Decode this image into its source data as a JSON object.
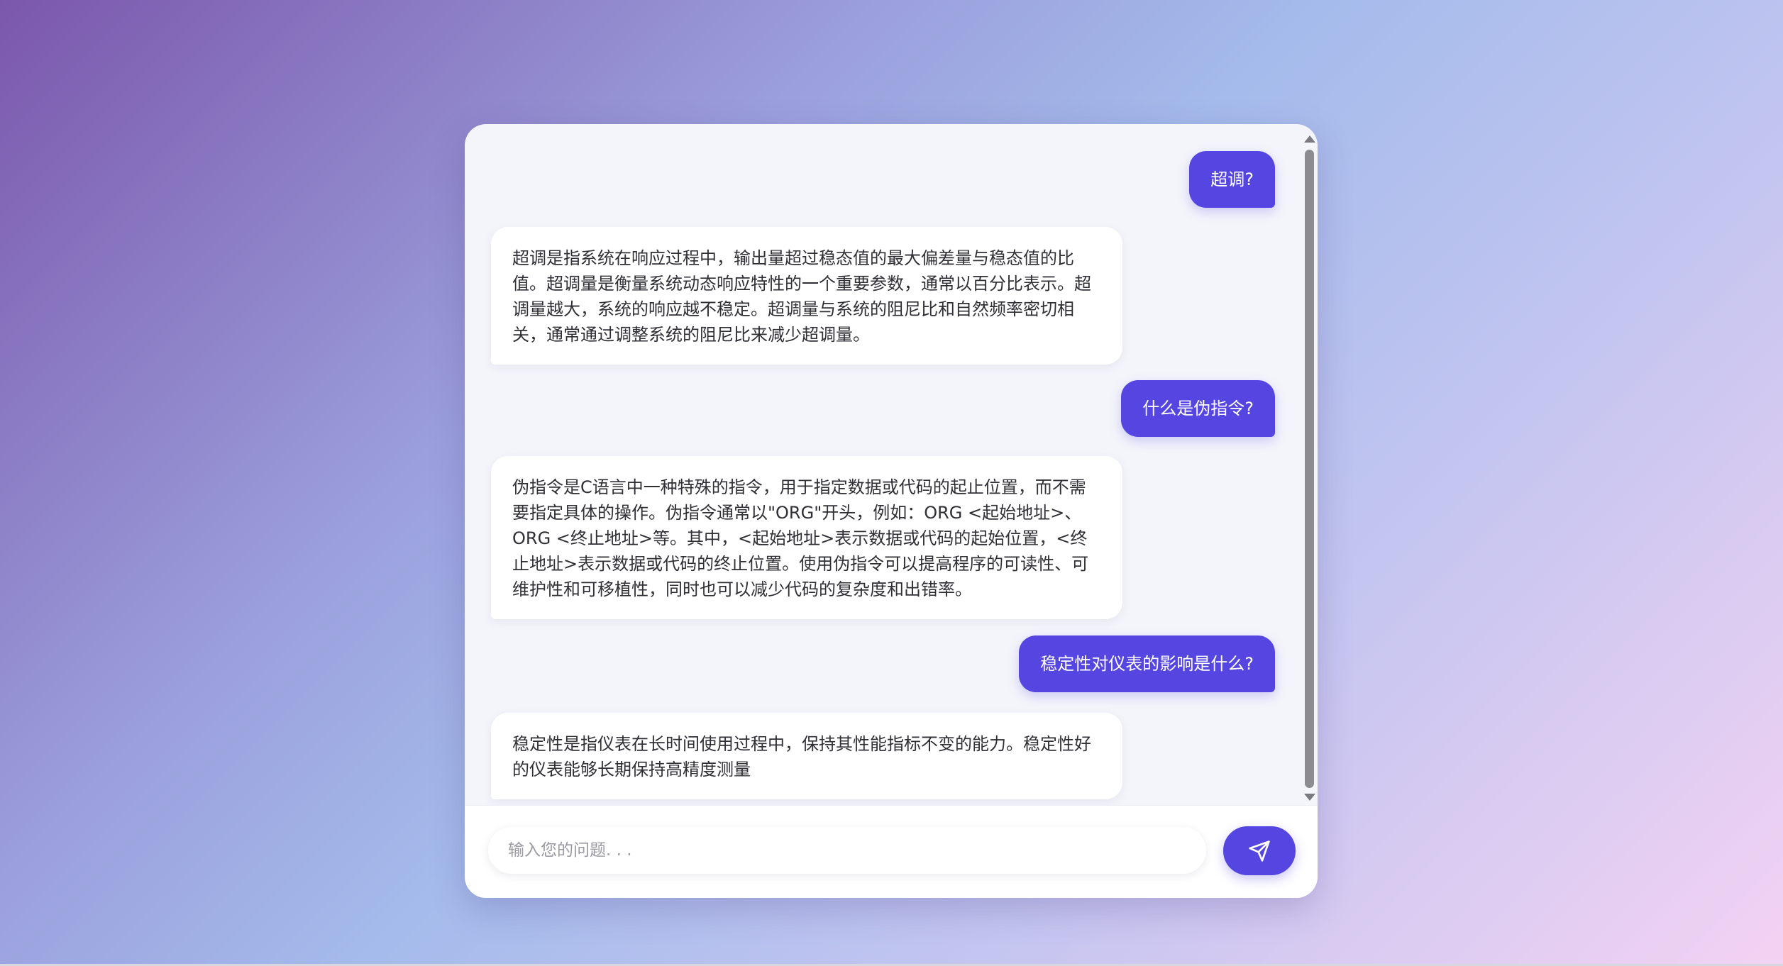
{
  "chat": {
    "messages": [
      {
        "role": "user",
        "text": "超调?"
      },
      {
        "role": "bot",
        "text": "超调是指系统在响应过程中，输出量超过稳态值的最大偏差量与稳态值的比值。超调量是衡量系统动态响应特性的一个重要参数，通常以百分比表示。超调量越大，系统的响应越不稳定。超调量与系统的阻尼比和自然频率密切相关，通常通过调整系统的阻尼比来减少超调量。"
      },
      {
        "role": "user",
        "text": "什么是伪指令?"
      },
      {
        "role": "bot",
        "text": "伪指令是C语言中一种特殊的指令，用于指定数据或代码的起止位置，而不需要指定具体的操作。伪指令通常以\"ORG\"开头，例如：ORG <起始地址>、ORG <终止地址>等。其中，<起始地址>表示数据或代码的起始位置，<终止地址>表示数据或代码的终止位置。使用伪指令可以提高程序的可读性、可维护性和可移植性，同时也可以减少代码的复杂度和出错率。"
      },
      {
        "role": "user",
        "text": "稳定性对仪表的影响是什么?"
      },
      {
        "role": "bot",
        "text": "稳定性是指仪表在长时间使用过程中，保持其性能指标不变的能力。稳定性好的仪表能够长期保持高精度测量"
      }
    ]
  },
  "input": {
    "placeholder": "输入您的问题. . ."
  },
  "send_button": {
    "icon": "send-icon"
  },
  "colors": {
    "accent": "#5546e2",
    "bot_bubble": "#ffffff",
    "window_bg": "#f4f5fb"
  }
}
